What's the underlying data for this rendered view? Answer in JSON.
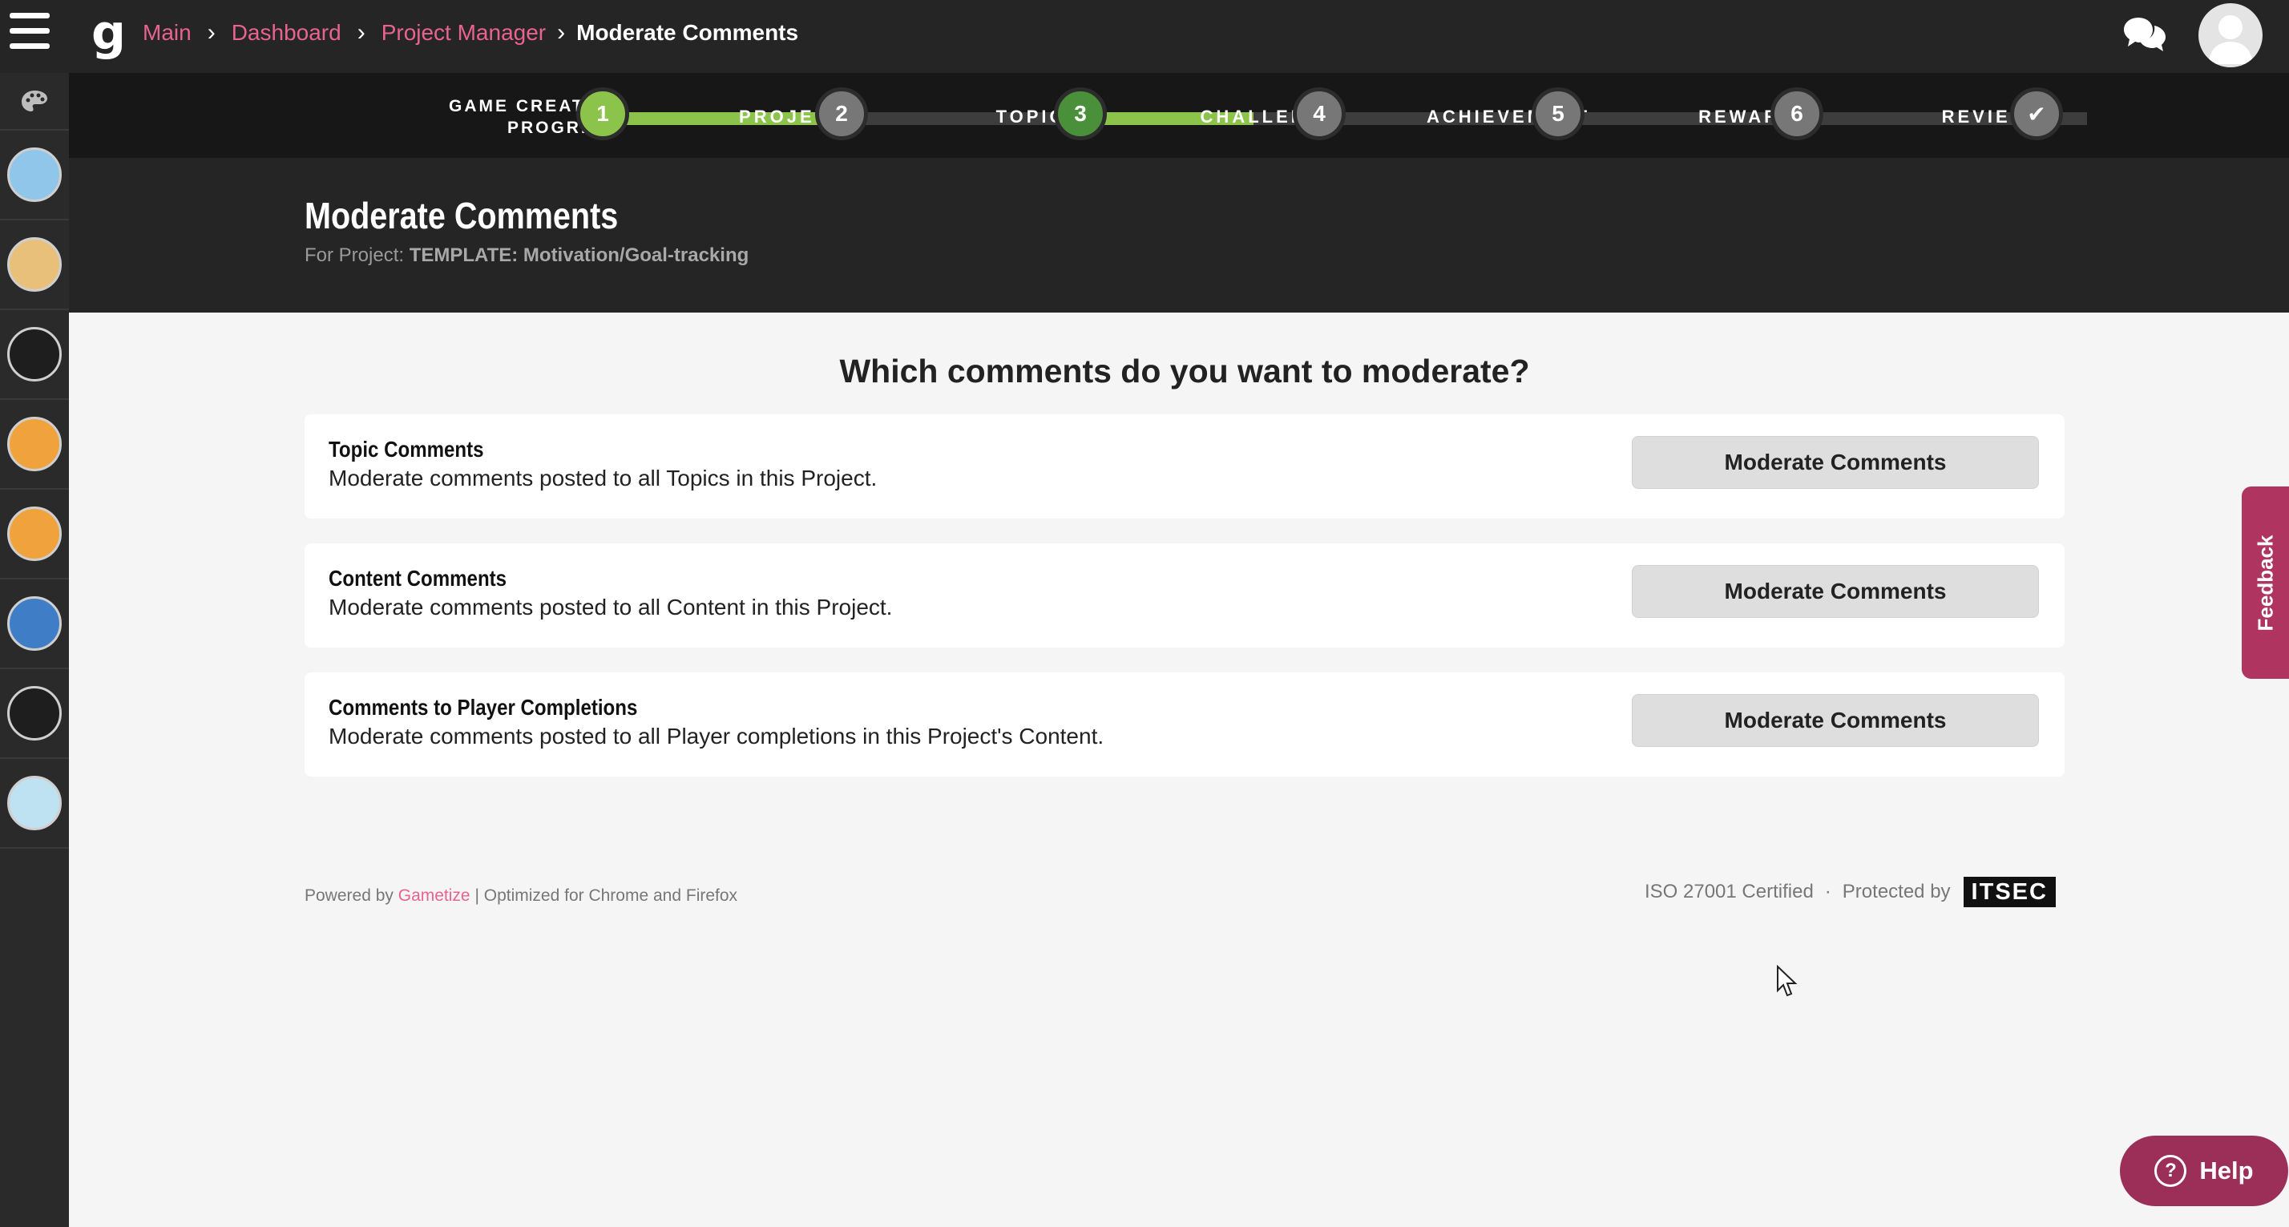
{
  "topbar": {
    "logo": "g",
    "breadcrumb": {
      "main": "Main",
      "dashboard": "Dashboard",
      "project_manager": "Project Manager",
      "current": "Moderate Comments",
      "separator": "›"
    }
  },
  "progress": {
    "label_line1": "GAME CREATION",
    "label_line2": "PROGRESS",
    "steps": [
      {
        "number": "1",
        "label": "PROJECT"
      },
      {
        "number": "2",
        "label": "TOPIC"
      },
      {
        "number": "3",
        "label": "CHALLENGE"
      },
      {
        "number": "4",
        "label": "ACHIEVEMENT"
      },
      {
        "number": "5",
        "label": "REWARD"
      },
      {
        "number": "6",
        "label": "REVIEW"
      }
    ],
    "final_icon": "✔"
  },
  "header": {
    "title": "Moderate Comments",
    "project_prefix": "For Project:",
    "project_name": "TEMPLATE: Motivation/Goal-tracking"
  },
  "main": {
    "question": "Which comments do you want to moderate?",
    "cards": [
      {
        "title": "Topic Comments",
        "description": "Moderate comments posted to all Topics in this Project.",
        "button": "Moderate Comments"
      },
      {
        "title": "Content Comments",
        "description": "Moderate comments posted to all Content in this Project.",
        "button": "Moderate Comments"
      },
      {
        "title": "Comments to Player Completions",
        "description": "Moderate comments posted to all Player completions in this Project's Content.",
        "button": "Moderate Comments"
      }
    ]
  },
  "footer": {
    "powered_by": "Powered by",
    "brand": "Gametize",
    "optimized": "| Optimized for Chrome and Firefox",
    "iso": "ISO 27001 Certified",
    "dot": "·",
    "protected": "Protected by",
    "itsec": "ITSEC"
  },
  "feedback_label": "Feedback",
  "help_label": "Help",
  "help_q": "?",
  "colors": {
    "accent_pink": "#e8638e",
    "progress_green": "#8cc34a",
    "dark_green": "#4a8f3a",
    "feedback": "#b03460",
    "help": "#9c2f57"
  }
}
